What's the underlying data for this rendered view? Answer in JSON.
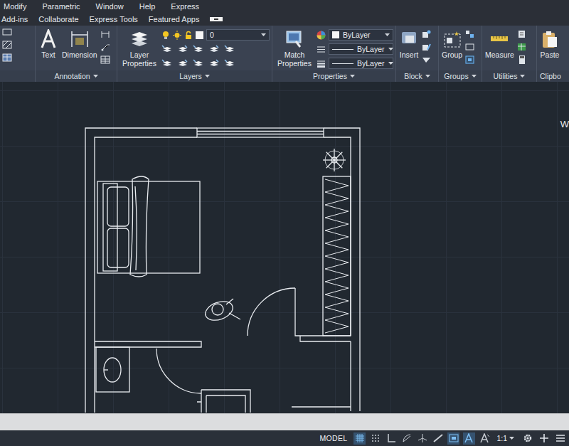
{
  "menu_bar": [
    "Modify",
    "Parametric",
    "Window",
    "Help",
    "Express"
  ],
  "ribbon_tabs": [
    {
      "label": "Add-ins",
      "selected": false
    },
    {
      "label": "Collaborate",
      "selected": false
    },
    {
      "label": "Express Tools",
      "selected": false
    },
    {
      "label": "Featured Apps",
      "selected": false
    }
  ],
  "ribbon": {
    "annotation": {
      "title": "Annotation",
      "has_menu": true,
      "text_button": "Text",
      "dimension_button": "Dimension"
    },
    "layers": {
      "title": "Layers",
      "has_menu": true,
      "properties_button": "Layer Properties",
      "current_layer": "0"
    },
    "properties": {
      "title": "Properties",
      "has_menu": true,
      "match_button": "Match Properties",
      "color": "ByLayer",
      "linetype": "ByLayer",
      "lineweight": "ByLayer"
    },
    "block": {
      "title": "Block",
      "has_menu": true,
      "insert_button": "Insert"
    },
    "groups": {
      "title": "Groups",
      "has_menu": true,
      "group_button": "Group"
    },
    "utilities": {
      "title": "Utilities",
      "has_menu": true,
      "measure_button": "Measure"
    },
    "clipboard": {
      "title": "Clipbo",
      "has_menu": false,
      "paste_button": "Paste"
    }
  },
  "viewcube": {
    "label": "W"
  },
  "status_bar": {
    "space": "MODEL",
    "toggles": [
      {
        "kind": "grid",
        "on": true
      },
      {
        "kind": "snap",
        "on": false
      },
      {
        "kind": "ortho",
        "on": false
      },
      {
        "kind": "polar",
        "on": false
      },
      {
        "kind": "isodraft",
        "on": false
      },
      {
        "kind": "lineweight",
        "on": false
      },
      {
        "kind": "selection",
        "on": true
      },
      {
        "kind": "annovisibility",
        "on": true
      },
      {
        "kind": "autoscale",
        "on": false
      }
    ],
    "scale": "1:1"
  }
}
